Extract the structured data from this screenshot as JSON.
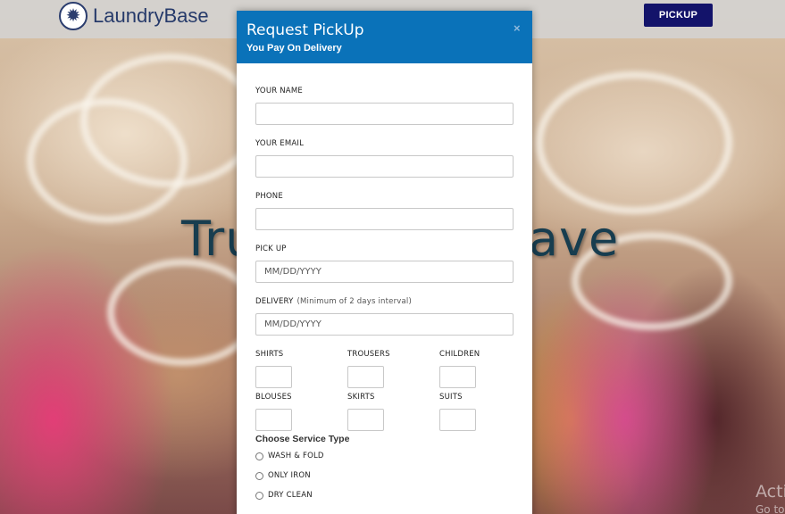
{
  "navbar": {
    "brand_name": "LaundryBase",
    "logo_icon": "gear-logo-icon",
    "pickup_label": "PICKUP"
  },
  "hero": {
    "title_left": "Tru",
    "title_right": "ave"
  },
  "modal": {
    "title": "Request PickUp",
    "subtitle": "You Pay On Delivery",
    "close_label": "×",
    "fields": {
      "name_label": "YOUR NAME",
      "email_label": "YOUR EMAIL",
      "phone_label": "PHONE",
      "pickup_label": "PICK UP",
      "pickup_placeholder": "MM/DD/YYYY",
      "delivery_label": "DELIVERY",
      "delivery_hint": "(Minimum of 2 days interval)",
      "delivery_placeholder": "MM/DD/YYYY"
    },
    "quantities": [
      {
        "label": "SHIRTS"
      },
      {
        "label": "TROUSERS"
      },
      {
        "label": "CHILDREN"
      },
      {
        "label": "BLOUSES"
      },
      {
        "label": "SKIRTS"
      },
      {
        "label": "SUITS"
      }
    ],
    "service_heading": "Choose Service Type",
    "services": [
      {
        "label": "WASH & FOLD"
      },
      {
        "label": "ONLY IRON"
      },
      {
        "label": "DRY CLEAN"
      }
    ]
  },
  "watermark": {
    "title": "Acti",
    "subtitle": "Go to"
  },
  "colors": {
    "modal_header": "#0a72b9",
    "nav_button": "#13136a",
    "brand_text": "#263a6a"
  }
}
